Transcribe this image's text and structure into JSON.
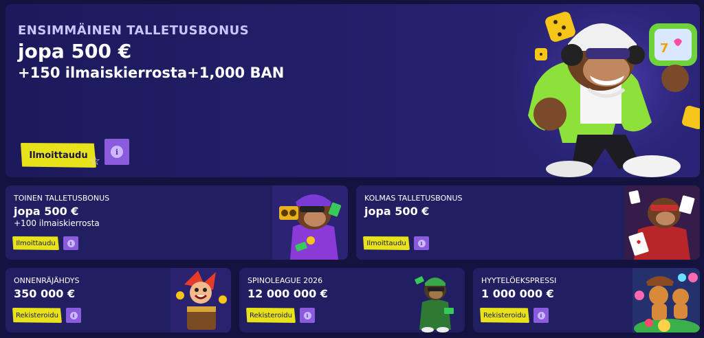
{
  "hero": {
    "eyebrow": "ENSIMMÄINEN TALLETUSBONUS",
    "headline": "jopa 500 €",
    "sub": "+150 ilmaiskierrosta+1,000 BAN",
    "signup_label": "Ilmoittaudu",
    "info_icon": "i"
  },
  "cards": [
    {
      "label": "TOINEN TALLETUSBONUS",
      "amount": "jopa 500 €",
      "extra": "+100 ilmaiskierrosta",
      "button": "Ilmoittaudu",
      "info_icon": "i"
    },
    {
      "label": "KOLMAS TALLETUSBONUS",
      "amount": "jopa 500 €",
      "button": "Ilmoittaudu",
      "info_icon": "i"
    },
    {
      "label": "ONNENRÄJÄHDYS",
      "amount": "350 000 €",
      "button": "Rekisteroidu",
      "info_icon": "i"
    },
    {
      "label": "SPINOLEAGUE 2026",
      "amount": "12 000 000 €",
      "button": "Rekisteroidu",
      "info_icon": "i"
    },
    {
      "label": "HYYTELÖEKSPRESSI",
      "amount": "1 000 000 €",
      "button": "Rekisteroidu",
      "info_icon": "i"
    }
  ],
  "colors": {
    "background": "#14123f",
    "card": "#221e62",
    "button_yellow": "#e8e21a",
    "info_purple": "#8a5cdd"
  }
}
